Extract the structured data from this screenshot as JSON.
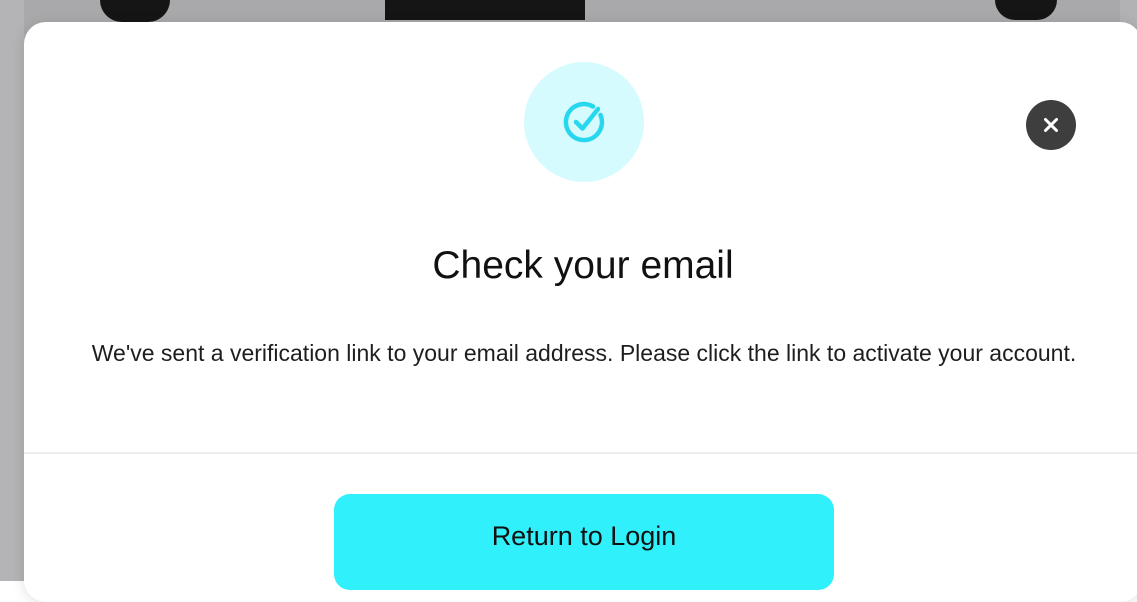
{
  "modal": {
    "icon": "check-circle-icon",
    "close_icon": "close-icon",
    "title": "Check your email",
    "message": "We've sent a verification link to your email address. Please click the link to activate your account.",
    "primary_button": "Return to Login"
  },
  "colors": {
    "accent": "#2ff0fb",
    "icon_badge_bg": "#d6fbff",
    "icon_stroke": "#26d7ee",
    "close_bg": "#3e3e3e",
    "overlay": "#a9a9ab"
  }
}
